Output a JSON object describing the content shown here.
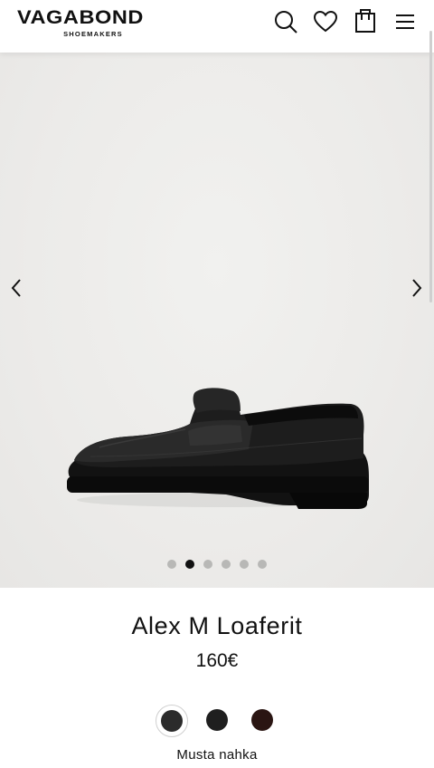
{
  "header": {
    "brand_name": "VAGABOND",
    "brand_tagline": "SHOEMAKERS",
    "icons": [
      "search-icon",
      "heart-icon",
      "bag-icon",
      "menu-icon"
    ]
  },
  "gallery": {
    "image": "black-penny-loafer",
    "total_images": 6,
    "active_index": 1
  },
  "product": {
    "name": "Alex M Loaferit",
    "price": "160€",
    "color_name": "Musta nahka",
    "swatches": [
      {
        "color": "#2b2b2b",
        "selected": true
      },
      {
        "color": "#1f1f1f",
        "selected": false
      },
      {
        "color": "#2a1512",
        "selected": false
      }
    ]
  }
}
